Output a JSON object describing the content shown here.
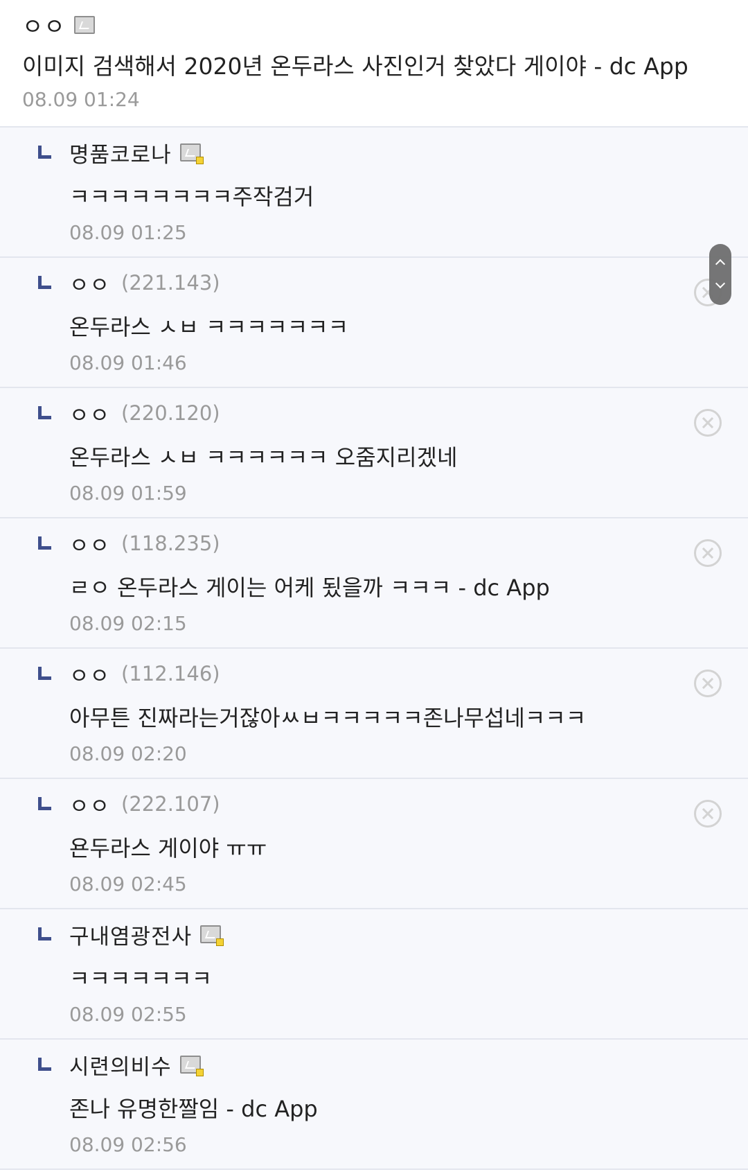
{
  "parent": {
    "author": "ㅇㅇ",
    "text": "이미지 검색해서 2020년 온두라스 사진인거 찾았다 게이야 - dc App",
    "date": "08.09 01:24"
  },
  "replies": [
    {
      "author": "명품코로나",
      "ip": "",
      "text": "ㅋㅋㅋㅋㅋㅋㅋㅋ주작검거",
      "date": "08.09 01:25"
    },
    {
      "author": "ㅇㅇ",
      "ip": "(221.143)",
      "text": "온두라스 ㅅㅂ ㅋㅋㅋㅋㅋㅋㅋ",
      "date": "08.09 01:46"
    },
    {
      "author": "ㅇㅇ",
      "ip": "(220.120)",
      "text": "온두라스 ㅅㅂ ㅋㅋㅋㅋㅋㅋ 오줌지리겠네",
      "date": "08.09 01:59"
    },
    {
      "author": "ㅇㅇ",
      "ip": "(118.235)",
      "text": "ㄹㅇ 온두라스 게이는 어케 됬을까 ㅋㅋㅋ - dc App",
      "date": "08.09 02:15"
    },
    {
      "author": "ㅇㅇ",
      "ip": "(112.146)",
      "text": "아무튼 진짜라는거잖아ㅆㅂㅋㅋㅋㅋㅋ존나무섭네ㅋㅋㅋ",
      "date": "08.09 02:20"
    },
    {
      "author": "ㅇㅇ",
      "ip": "(222.107)",
      "text": "욘두라스 게이야 ㅠㅠ",
      "date": "08.09 02:45"
    },
    {
      "author": "구내염광전사",
      "ip": "",
      "text": "ㅋㅋㅋㅋㅋㅋㅋ",
      "date": "08.09 02:55"
    },
    {
      "author": "시련의비수",
      "ip": "",
      "text": "존나 유명한짤임 - dc App",
      "date": "08.09 02:56"
    }
  ]
}
